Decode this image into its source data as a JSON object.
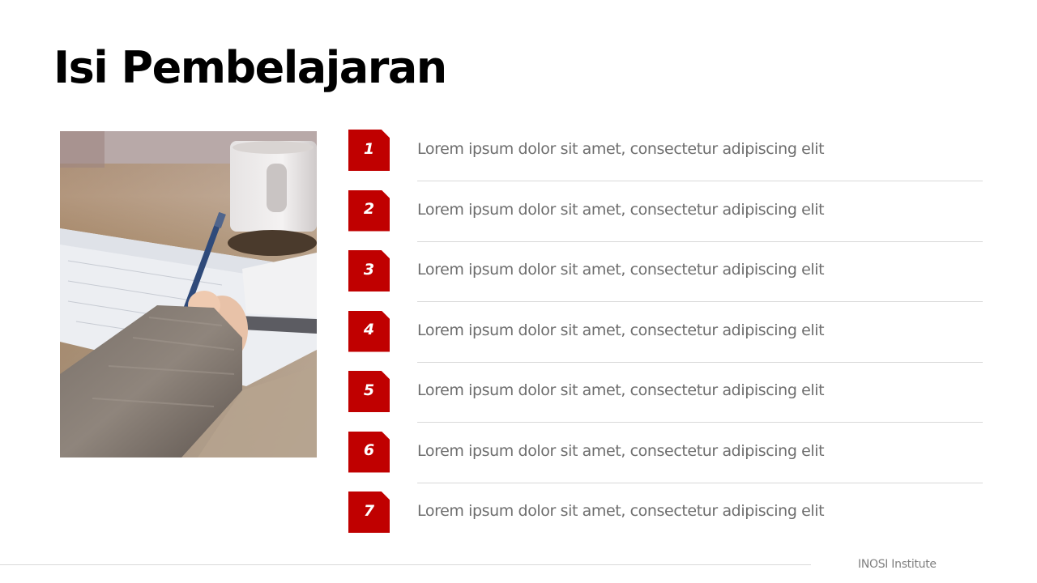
{
  "slide": {
    "title": "Isi Pembelajaran"
  },
  "photo": {
    "description_icon": "writing-hand-photo"
  },
  "agenda": {
    "items": [
      {
        "number": "1",
        "text": "Lorem ipsum dolor sit amet, consectetur adipiscing elit"
      },
      {
        "number": "2",
        "text": "Lorem ipsum dolor sit amet, consectetur adipiscing elit"
      },
      {
        "number": "3",
        "text": "Lorem ipsum dolor sit amet, consectetur adipiscing elit"
      },
      {
        "number": "4",
        "text": "Lorem ipsum dolor sit amet, consectetur adipiscing elit"
      },
      {
        "number": "5",
        "text": "Lorem ipsum dolor sit amet, consectetur adipiscing elit"
      },
      {
        "number": "6",
        "text": "Lorem ipsum dolor sit amet, consectetur adipiscing elit"
      },
      {
        "number": "7",
        "text": "Lorem ipsum dolor sit amet, consectetur adipiscing elit"
      }
    ]
  },
  "footer": {
    "brand": "INOSI Institute"
  },
  "colors": {
    "accent": "#c00000",
    "body_text": "#6e6e6e",
    "divider": "#d9d9d9",
    "title": "#000000"
  }
}
